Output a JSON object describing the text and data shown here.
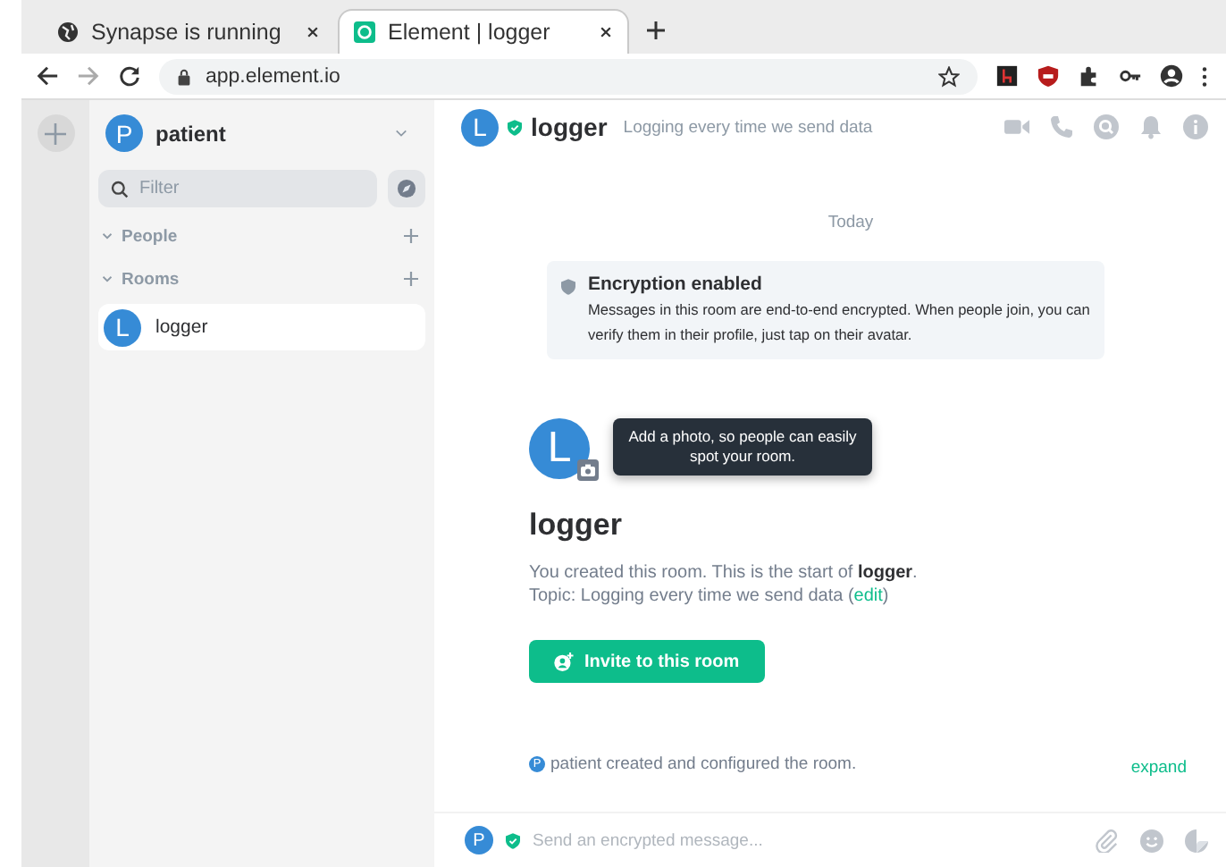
{
  "browser": {
    "tabs": [
      {
        "title": "Synapse is running",
        "selected": false
      },
      {
        "title": "Element | logger",
        "selected": true
      }
    ],
    "url": "app.element.io"
  },
  "sidebar": {
    "user": {
      "avatar": "P",
      "name": "patient"
    },
    "filter": {
      "placeholder": "Filter"
    },
    "sections": [
      {
        "label": "People",
        "expanded": true
      },
      {
        "label": "Rooms",
        "expanded": true,
        "rooms": [
          {
            "avatar": "L",
            "name": "logger",
            "selected": true
          }
        ]
      }
    ]
  },
  "room_header": {
    "avatar": "L",
    "name": "logger",
    "topic": "Logging every time we send data"
  },
  "timeline": {
    "date": "Today",
    "encryption": {
      "title": "Encryption enabled",
      "text": "Messages in this room are end-to-end encrypted. When people join, you can verify them in their profile, just tap on their avatar."
    },
    "intro": {
      "avatar": "L",
      "tooltip": "Add a photo, so people can easily spot your room.",
      "name": "logger",
      "text": "You created this room. This is the start of **logger**.",
      "topic_prefix": "Topic: Logging every time we send data (",
      "topic_link": "edit",
      "topic_suffix": ")",
      "invite_button": "Invite to this room"
    },
    "event": {
      "avatar": "P",
      "text": "patient created and configured the room.",
      "expand": "expand"
    }
  },
  "composer": {
    "avatar": "P",
    "placeholder": "Send an encrypted message..."
  }
}
